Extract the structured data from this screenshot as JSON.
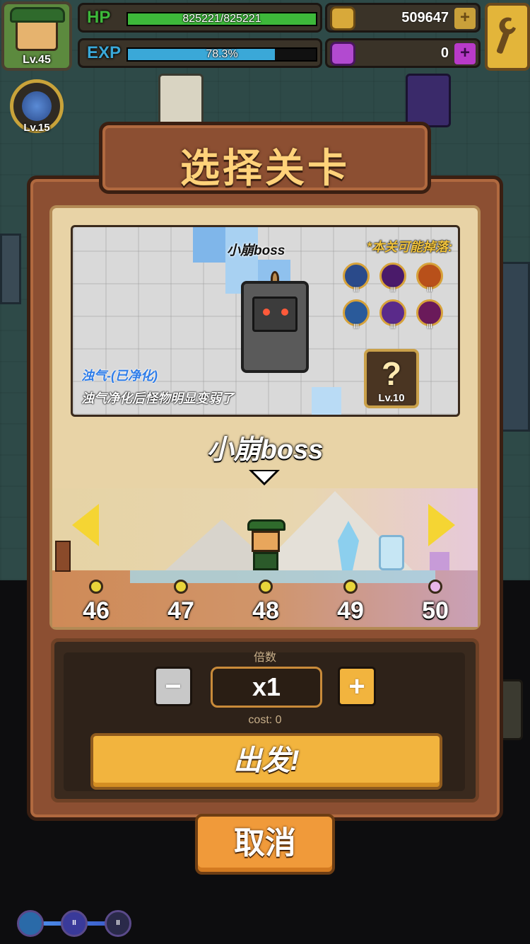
{
  "hud": {
    "player_level": "Lv.45",
    "hp_label": "HP",
    "hp_text": "825221/825221",
    "hp_fraction": 1.0,
    "exp_label": "EXP",
    "exp_text": "78.3%",
    "exp_fraction": 0.783,
    "gold_value": "509647",
    "gem_value": "0",
    "plus_symbol": "+",
    "skill_level": "Lv.15"
  },
  "dialog": {
    "title": "选择关卡",
    "boss_card": {
      "boss_name": "小崩boss",
      "drop_title": "*本关可能掉落:",
      "drop_icons": [
        {
          "icon": "lightning-rune-icon",
          "tier": "III"
        },
        {
          "icon": "void-rune-icon",
          "tier": "III"
        },
        {
          "icon": "fire-rune-icon",
          "tier": "III"
        },
        {
          "icon": "ice-rune-icon",
          "tier": "III"
        },
        {
          "icon": "shadow-rune-icon",
          "tier": "III"
        },
        {
          "icon": "skull-rune-icon",
          "tier": "III"
        }
      ],
      "mystery_symbol": "?",
      "mystery_level": "Lv.10",
      "status_name": "浊气-(已净化)",
      "status_desc": "浊气净化后怪物明显变弱了"
    },
    "stage_name": "小崩boss",
    "stages": [
      {
        "number": "46",
        "state": "cleared"
      },
      {
        "number": "47",
        "state": "cleared"
      },
      {
        "number": "48",
        "state": "current"
      },
      {
        "number": "49",
        "state": "cleared"
      },
      {
        "number": "50",
        "state": "boss"
      }
    ],
    "multiplier_label": "倍数",
    "minus_symbol": "−",
    "plus_symbol": "+",
    "multiplier_value": "x1",
    "cost_text": "cost: 0",
    "go_label": "出发!",
    "cancel_label": "取消"
  },
  "bottom_skills": [
    {
      "icon": "wind-skill-icon",
      "tier": ""
    },
    {
      "icon": "claw-skill-icon",
      "tier": "II"
    },
    {
      "icon": "vine-skill-icon",
      "tier": "II"
    }
  ],
  "colors": {
    "hp_bar": "#3db83a",
    "exp_bar": "#3aa8d8",
    "accent_gold": "#f2b43e",
    "cancel_orange": "#f09a3a",
    "panel_brown": "#8c4f32"
  }
}
